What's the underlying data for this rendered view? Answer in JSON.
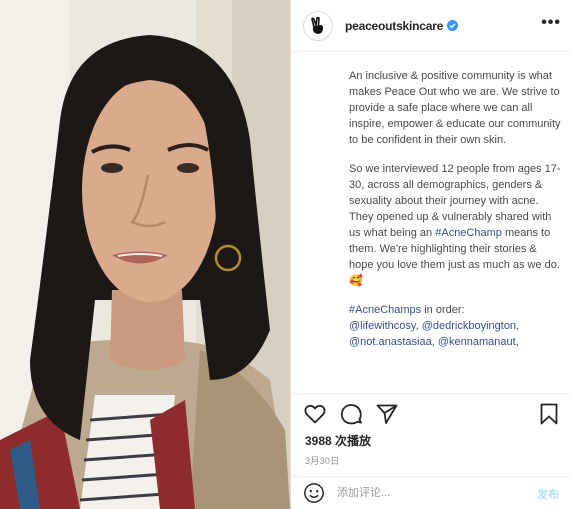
{
  "header": {
    "username": "peaceoutskincare",
    "more_label": "•••"
  },
  "caption": {
    "paragraph1": "An inclusive & positive community is what makes Peace Out who we are. We strive to provide a safe place where we can all inspire, empower & educate our community to be confident in their own skin.",
    "p2_before": "So we interviewed 12 people from ages 17-30, across all demographics, genders & sexuality about their journey with acne. They opened up & vulnerably shared with us what being an ",
    "p2_hashtag": "#AcneChamp",
    "p2_after": " means to them. We're highlighting their stories & hope you love them just as much as we do. 🥰",
    "p3_hashtag": "#AcneChamps",
    "p3_text": " in order:",
    "mention1": "@lifewithcosy",
    "mention2": "@dedrickboyington",
    "mention3": "@not.anastasiaa",
    "mention4": "@kennamanaut"
  },
  "stats": {
    "views": "3988 次播放",
    "date": "3月30日"
  },
  "comment": {
    "placeholder": "添加评论...",
    "post_label": "发布"
  },
  "colors": {
    "verified": "#3897f0",
    "link": "#385185",
    "post_button_disabled": "#b2dffc"
  },
  "icons": {
    "avatar": "peace-hand-icon",
    "like": "heart-icon",
    "comment": "comment-bubble-icon",
    "share": "paper-plane-icon",
    "save": "bookmark-icon",
    "emoji": "smiley-icon",
    "verified": "verified-badge-icon"
  }
}
